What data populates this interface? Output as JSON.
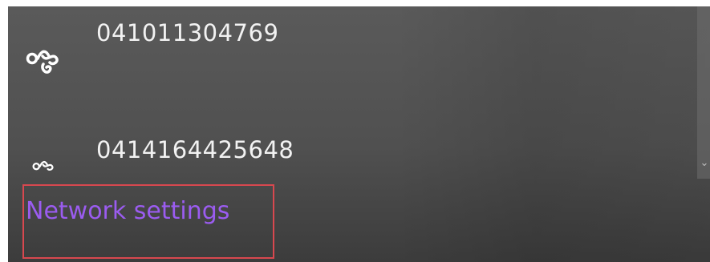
{
  "networks": [
    {
      "name": "041011304769",
      "icon": "cellular-link-icon"
    },
    {
      "name": "0414164425648",
      "icon": "cellular-link-icon"
    }
  ],
  "network_settings": {
    "label": "Network settings",
    "color": "#9b5cf0"
  },
  "highlight_color": "#d8484f"
}
